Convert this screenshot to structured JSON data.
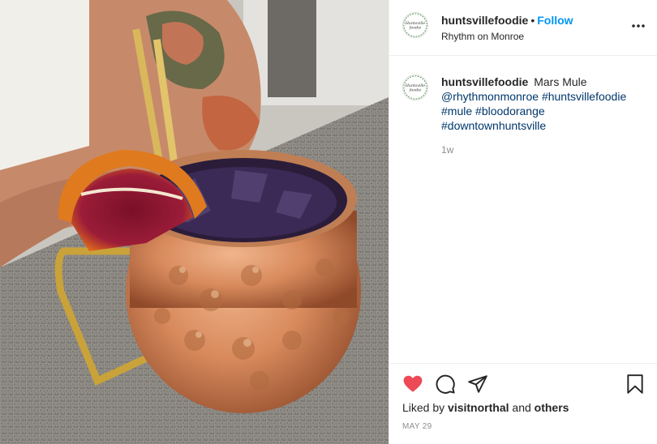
{
  "post": {
    "username": "huntsvillefoodie",
    "separator": "•",
    "follow_label": "Follow",
    "location": "Rhythm on Monroe",
    "more_icon": "more-horizontal-icon",
    "avatar_text": "Huntsville foodie"
  },
  "caption": {
    "username": "huntsvillefoodie",
    "text": "Mars Mule",
    "mention": "@rhythmonmonroe",
    "mention2": "#huntsvillefoodie",
    "tag1": "#mule",
    "tag2": "#bloodorange",
    "tag3": "#downtownhuntsville",
    "age": "1w"
  },
  "actions": {
    "like_icon": "heart-filled-icon",
    "comment_icon": "comment-icon",
    "share_icon": "share-icon",
    "save_icon": "bookmark-icon",
    "like_color": "#ed4956"
  },
  "likes": {
    "prefix": "Liked by",
    "user": "visitnorthal",
    "conj": "and",
    "others": "others"
  },
  "date": "MAY 29"
}
